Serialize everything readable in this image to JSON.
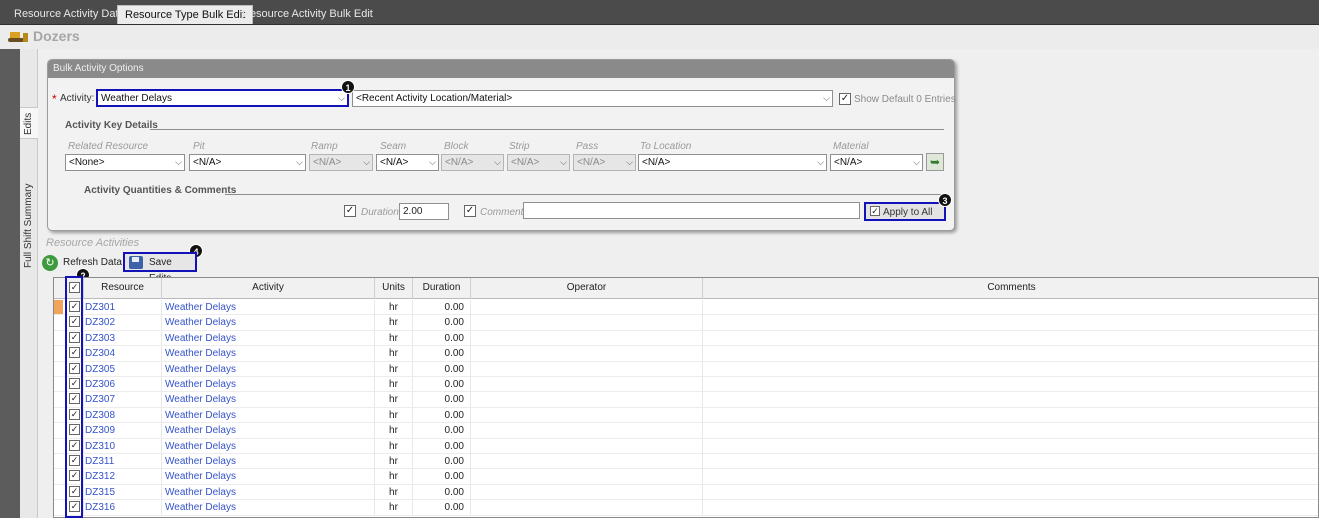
{
  "tabs": [
    {
      "label": "Resource Activity Data",
      "active": false
    },
    {
      "label": "Resource Type Bulk Edit",
      "active": true
    },
    {
      "label": "Resource Activity Bulk Edit",
      "active": false
    }
  ],
  "page": {
    "title": "Dozers",
    "icon": "dozer-icon"
  },
  "side_tabs": {
    "edits": "Edits",
    "summary": "Full Shift Summary"
  },
  "bulk": {
    "panel_title": "Bulk Activity Options",
    "activity_label": "Activity:",
    "activity_value": "Weather Delays",
    "location_value": "<Recent Activity Location/Material>",
    "show_default_label": "Show Default 0 Entries",
    "key_details_label": "Activity Key Details",
    "fields": {
      "related_resource": {
        "label": "Related Resource",
        "value": "<None>"
      },
      "pit": {
        "label": "Pit",
        "value": "<N/A>"
      },
      "ramp": {
        "label": "Ramp",
        "value": "<N/A>"
      },
      "seam": {
        "label": "Seam",
        "value": "<N/A>"
      },
      "block": {
        "label": "Block",
        "value": "<N/A>"
      },
      "strip": {
        "label": "Strip",
        "value": "<N/A>"
      },
      "pass": {
        "label": "Pass",
        "value": "<N/A>"
      },
      "to_location": {
        "label": "To Location",
        "value": "<N/A>"
      },
      "material": {
        "label": "Material",
        "value": "<N/A>"
      }
    },
    "quantities_label": "Activity Quantities & Comments",
    "duration_label": "Duration",
    "duration_value": "2.00",
    "comment_label": "Comment",
    "comment_value": "",
    "apply_label": "Apply to All"
  },
  "callouts": [
    "1",
    "2",
    "3",
    "4"
  ],
  "resource_activities": {
    "title": "Resource Activities",
    "refresh_label": "Refresh Data",
    "save_label": "Save Edits"
  },
  "grid": {
    "columns": [
      "Resource",
      "Activity",
      "Units",
      "Duration",
      "Operator",
      "Comments"
    ],
    "rows": [
      {
        "resource": "DZ301",
        "activity": "Weather Delays",
        "units": "hr",
        "duration": "0.00",
        "operator": "",
        "comments": ""
      },
      {
        "resource": "DZ302",
        "activity": "Weather Delays",
        "units": "hr",
        "duration": "0.00",
        "operator": "",
        "comments": ""
      },
      {
        "resource": "DZ303",
        "activity": "Weather Delays",
        "units": "hr",
        "duration": "0.00",
        "operator": "",
        "comments": ""
      },
      {
        "resource": "DZ304",
        "activity": "Weather Delays",
        "units": "hr",
        "duration": "0.00",
        "operator": "",
        "comments": ""
      },
      {
        "resource": "DZ305",
        "activity": "Weather Delays",
        "units": "hr",
        "duration": "0.00",
        "operator": "",
        "comments": ""
      },
      {
        "resource": "DZ306",
        "activity": "Weather Delays",
        "units": "hr",
        "duration": "0.00",
        "operator": "",
        "comments": ""
      },
      {
        "resource": "DZ307",
        "activity": "Weather Delays",
        "units": "hr",
        "duration": "0.00",
        "operator": "",
        "comments": ""
      },
      {
        "resource": "DZ308",
        "activity": "Weather Delays",
        "units": "hr",
        "duration": "0.00",
        "operator": "",
        "comments": ""
      },
      {
        "resource": "DZ309",
        "activity": "Weather Delays",
        "units": "hr",
        "duration": "0.00",
        "operator": "",
        "comments": ""
      },
      {
        "resource": "DZ310",
        "activity": "Weather Delays",
        "units": "hr",
        "duration": "0.00",
        "operator": "",
        "comments": ""
      },
      {
        "resource": "DZ311",
        "activity": "Weather Delays",
        "units": "hr",
        "duration": "0.00",
        "operator": "",
        "comments": ""
      },
      {
        "resource": "DZ312",
        "activity": "Weather Delays",
        "units": "hr",
        "duration": "0.00",
        "operator": "",
        "comments": ""
      },
      {
        "resource": "DZ315",
        "activity": "Weather Delays",
        "units": "hr",
        "duration": "0.00",
        "operator": "",
        "comments": ""
      },
      {
        "resource": "DZ316",
        "activity": "Weather Delays",
        "units": "hr",
        "duration": "0.00",
        "operator": "",
        "comments": ""
      }
    ]
  },
  "colors": {
    "highlight": "#1212b8",
    "link": "#3553c8",
    "required": "#cc0000"
  }
}
